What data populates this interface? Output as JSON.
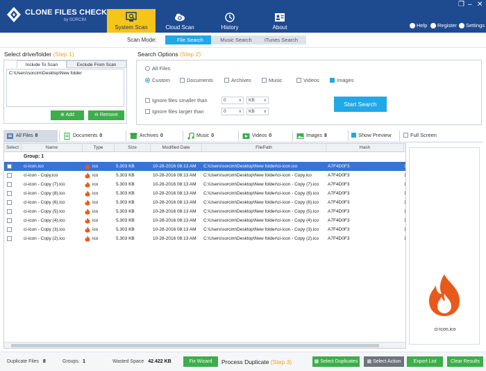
{
  "app": {
    "title": "CLONE FILES CHECKER",
    "subtitle": "by SORCIM",
    "window_controls": [
      "❐",
      "–",
      "✕"
    ]
  },
  "nav": [
    {
      "label": "System Scan",
      "icon": "system-scan-icon",
      "active": true
    },
    {
      "label": "Cloud Scan",
      "icon": "cloud-scan-icon",
      "active": false
    },
    {
      "label": "History",
      "icon": "history-icon",
      "active": false
    },
    {
      "label": "About",
      "icon": "about-icon",
      "active": false
    }
  ],
  "header_links": [
    {
      "label": "Help",
      "icon": "help-icon"
    },
    {
      "label": "Register",
      "icon": "register-icon"
    },
    {
      "label": "Settings",
      "icon": "gear-icon"
    }
  ],
  "scan_mode": {
    "label": "Scan Mode:",
    "tabs": [
      {
        "label": "File Search",
        "active": true
      },
      {
        "label": "Music Search",
        "active": false
      },
      {
        "label": "iTunes Search",
        "active": false
      }
    ]
  },
  "drive": {
    "title": "Select drive/folder",
    "step": "(Step 1)",
    "tabs": [
      "Include To Scan",
      "Exclude From Scan"
    ],
    "paths": [
      "C:\\Users\\sorcim\\Desktop\\New folder"
    ],
    "add_label": "Add",
    "remove_label": "Remove"
  },
  "search": {
    "title": "Search Options",
    "step": "(Step 2)",
    "all_files": "All Files",
    "custom": "Custom",
    "types": [
      {
        "label": "Documents",
        "checked": false
      },
      {
        "label": "Archives",
        "checked": false
      },
      {
        "label": "Music",
        "checked": false
      },
      {
        "label": "Videos",
        "checked": false
      },
      {
        "label": "Images",
        "checked": true
      }
    ],
    "ignore_smaller": "Ignore files smaller than",
    "ignore_larger": "Ignore files larger than",
    "size_value": "0",
    "unit": "KB",
    "start_label": "Start Search"
  },
  "categories": [
    {
      "label": "All Files",
      "count": "8",
      "icon": "all-files-icon",
      "active": true
    },
    {
      "label": "Documents",
      "count": "0",
      "icon": "documents-icon",
      "active": false
    },
    {
      "label": "Archives",
      "count": "0",
      "icon": "archives-icon",
      "active": false
    },
    {
      "label": "Music",
      "count": "0",
      "icon": "music-icon",
      "active": false
    },
    {
      "label": "Videos",
      "count": "0",
      "icon": "videos-icon",
      "active": false
    },
    {
      "label": "Images",
      "count": "8",
      "icon": "images-icon",
      "active": false
    }
  ],
  "show_preview": "Show Preview",
  "full_screen": "Full Screen",
  "table": {
    "columns": [
      "Select",
      "Name",
      "Type",
      "Size",
      "Modified Date",
      "FilePath",
      "Hash"
    ],
    "group_label": "Group:   1",
    "rows": [
      {
        "name": "ci-icon.ico",
        "type": "ico",
        "size": "5.303 KB",
        "date": "10-28-2016 08:13 AM",
        "path": "C:\\Users\\sorcim\\Desktop\\New folder\\ci-icon.ico",
        "hash": "A7F4D0F3",
        "extra": "1",
        "selected": true
      },
      {
        "name": "ci-icon - Copy.ico",
        "type": "ico",
        "size": "5.303 KB",
        "date": "10-28-2016 08:13 AM",
        "path": "C:\\Users\\sorcim\\Desktop\\New folder\\ci-icon - Copy.ico",
        "hash": "A7F4D0F3",
        "extra": "1",
        "selected": false
      },
      {
        "name": "ci-icon - Copy (7).ico",
        "type": "ico",
        "size": "5.303 KB",
        "date": "10-28-2016 08:13 AM",
        "path": "C:\\Users\\sorcim\\Desktop\\New folder\\ci-icon - Copy (7).ico",
        "hash": "A7F4D0F3",
        "extra": "1",
        "selected": false
      },
      {
        "name": "ci-icon - Copy (8).ico",
        "type": "ico",
        "size": "5.303 KB",
        "date": "10-28-2016 08:13 AM",
        "path": "C:\\Users\\sorcim\\Desktop\\New folder\\ci-icon - Copy (8).ico",
        "hash": "A7F4D0F3",
        "extra": "1",
        "selected": false
      },
      {
        "name": "ci-icon - Copy (6).ico",
        "type": "ico",
        "size": "5.303 KB",
        "date": "10-28-2016 08:13 AM",
        "path": "C:\\Users\\sorcim\\Desktop\\New folder\\ci-icon - Copy (6).ico",
        "hash": "A7F4D0F3",
        "extra": "1",
        "selected": false
      },
      {
        "name": "ci-icon - Copy (5).ico",
        "type": "ico",
        "size": "5.303 KB",
        "date": "10-28-2016 08:13 AM",
        "path": "C:\\Users\\sorcim\\Desktop\\New folder\\ci-icon - Copy (5).ico",
        "hash": "A7F4D0F3",
        "extra": "1",
        "selected": false
      },
      {
        "name": "ci-icon - Copy (4).ico",
        "type": "ico",
        "size": "5.303 KB",
        "date": "10-28-2016 08:13 AM",
        "path": "C:\\Users\\sorcim\\Desktop\\New folder\\ci-icon - Copy (4).ico",
        "hash": "A7F4D0F3",
        "extra": "1",
        "selected": false
      },
      {
        "name": "ci-icon - Copy (3).ico",
        "type": "ico",
        "size": "5.303 KB",
        "date": "10-28-2016 08:13 AM",
        "path": "C:\\Users\\sorcim\\Desktop\\New folder\\ci-icon - Copy (3).ico",
        "hash": "A7F4D0F3",
        "extra": "1",
        "selected": false
      },
      {
        "name": "ci-icon - Copy (2).ico",
        "type": "ico",
        "size": "5.303 KB",
        "date": "10-28-2016 08:13 AM",
        "path": "C:\\Users\\sorcim\\Desktop\\New folder\\ci-icon - Copy (2).ico",
        "hash": "A7F4D0F3",
        "extra": "1",
        "selected": false
      }
    ]
  },
  "preview": {
    "filename": "ci-icon.ico"
  },
  "status": {
    "duplicate_files_label": "Duplicate Files",
    "duplicate_files": "8",
    "groups_label": "Groups",
    "groups": "1",
    "wasted_label": "Wasted Space",
    "wasted": "42.422 KB"
  },
  "bottom": {
    "fix_wizard": "Fix Wizard",
    "process_title": "Process Duplicate",
    "process_step": "(Step 3)",
    "select_duplicates": "Select Duplicates",
    "select_action": "Select Action",
    "export_list": "Export List",
    "clear_results": "Clear Results"
  },
  "colors": {
    "header": "#1e4a90",
    "active_tab": "#f5c518",
    "accent_blue": "#23a7e6",
    "green": "#3cae4a",
    "grey_button": "#6d747c",
    "step": "#f0a020"
  }
}
